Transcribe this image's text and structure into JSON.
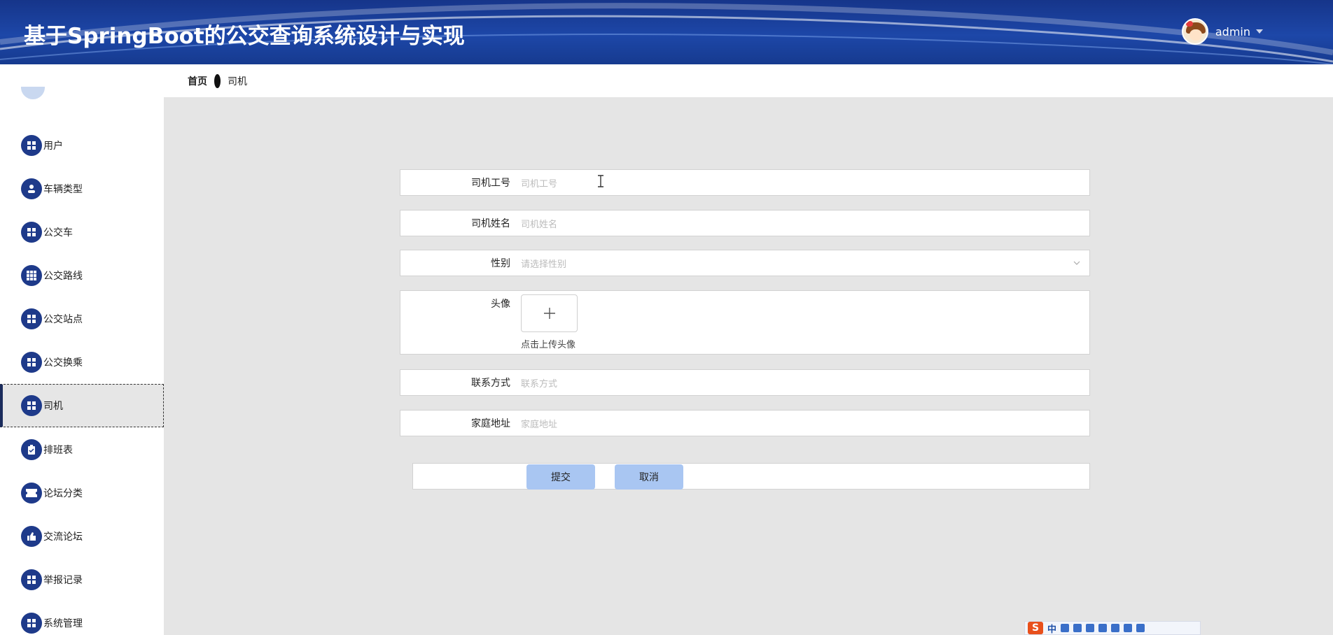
{
  "header": {
    "title": "基于SpringBoot的公交查询系统设计与实现",
    "username": "admin"
  },
  "breadcrumb": {
    "home": "首页",
    "current": "司机"
  },
  "sidebar": {
    "items": [
      {
        "label": "用户",
        "icon": "grid-icon"
      },
      {
        "label": "车辆类型",
        "icon": "user-icon"
      },
      {
        "label": "公交车",
        "icon": "grid-icon"
      },
      {
        "label": "公交路线",
        "icon": "apps-icon"
      },
      {
        "label": "公交站点",
        "icon": "grid-icon"
      },
      {
        "label": "公交换乘",
        "icon": "grid-icon"
      },
      {
        "label": "司机",
        "icon": "grid-icon",
        "active": true
      },
      {
        "label": "排班表",
        "icon": "clipboard-icon"
      },
      {
        "label": "论坛分类",
        "icon": "ticket-icon"
      },
      {
        "label": "交流论坛",
        "icon": "thumb-icon"
      },
      {
        "label": "举报记录",
        "icon": "grid-icon"
      },
      {
        "label": "系统管理",
        "icon": "grid-icon"
      }
    ]
  },
  "form": {
    "driver_no": {
      "label": "司机工号",
      "placeholder": "司机工号"
    },
    "driver_name": {
      "label": "司机姓名",
      "placeholder": "司机姓名"
    },
    "gender": {
      "label": "性别",
      "placeholder": "请选择性别"
    },
    "avatar": {
      "label": "头像",
      "tip": "点击上传头像"
    },
    "contact": {
      "label": "联系方式",
      "placeholder": "联系方式"
    },
    "address": {
      "label": "家庭地址",
      "placeholder": "家庭地址"
    }
  },
  "buttons": {
    "submit": "提交",
    "cancel": "取消"
  },
  "ime": {
    "logo": "S",
    "mode": "中"
  },
  "colors": {
    "header": "#1d47a8",
    "sidebar_icon": "#1e3a8a",
    "button": "#a9c6f2"
  }
}
